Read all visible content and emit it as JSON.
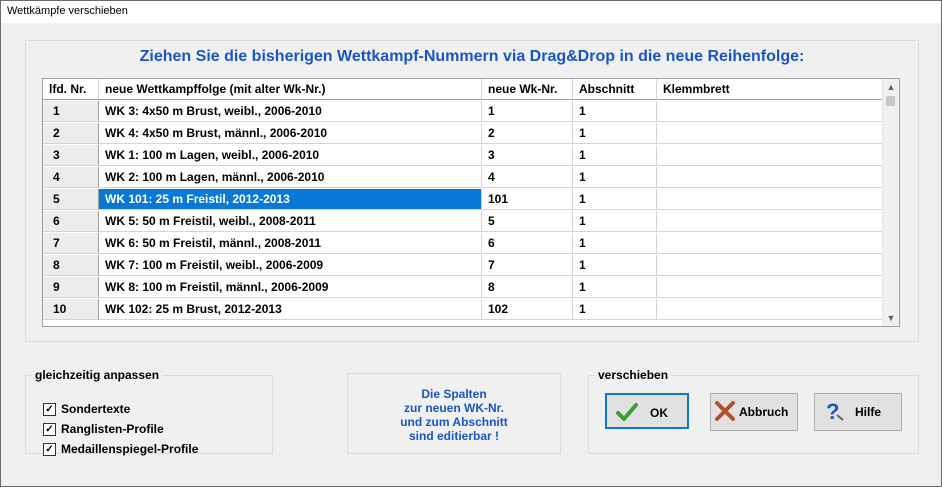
{
  "window": {
    "title": "Wettkämpfe verschieben"
  },
  "headline": "Ziehen Sie die bisherigen Wettkampf-Nummern via Drag&Drop in die neue Reihenfolge:",
  "grid": {
    "columns": [
      "lfd. Nr.",
      "neue Wettkampffolge  (mit alter Wk-Nr.)",
      "neue Wk-Nr.",
      "Abschnitt",
      "Klemmbrett"
    ],
    "rows": [
      {
        "nr": "1",
        "name": "WK 3: 4x50 m Brust, weibl., 2006-2010",
        "wknr": "1",
        "abschnitt": "1",
        "klemm": ""
      },
      {
        "nr": "2",
        "name": "WK 4: 4x50 m Brust, männl., 2006-2010",
        "wknr": "2",
        "abschnitt": "1",
        "klemm": ""
      },
      {
        "nr": "3",
        "name": "WK 1: 100 m Lagen, weibl., 2006-2010",
        "wknr": "3",
        "abschnitt": "1",
        "klemm": ""
      },
      {
        "nr": "4",
        "name": "WK 2: 100 m Lagen, männl., 2006-2010",
        "wknr": "4",
        "abschnitt": "1",
        "klemm": ""
      },
      {
        "nr": "5",
        "name": "WK 101: 25 m Freistil, 2012-2013",
        "wknr": "101",
        "abschnitt": "1",
        "klemm": "",
        "selected": true
      },
      {
        "nr": "6",
        "name": "WK 5: 50 m Freistil, weibl., 2008-2011",
        "wknr": "5",
        "abschnitt": "1",
        "klemm": ""
      },
      {
        "nr": "7",
        "name": "WK 6: 50 m Freistil, männl., 2008-2011",
        "wknr": "6",
        "abschnitt": "1",
        "klemm": ""
      },
      {
        "nr": "8",
        "name": "WK 7: 100 m Freistil, weibl., 2006-2009",
        "wknr": "7",
        "abschnitt": "1",
        "klemm": ""
      },
      {
        "nr": "9",
        "name": "WK 8: 100 m Freistil, männl., 2006-2009",
        "wknr": "8",
        "abschnitt": "1",
        "klemm": ""
      },
      {
        "nr": "10",
        "name": "WK 102: 25 m Brust, 2012-2013",
        "wknr": "102",
        "abschnitt": "1",
        "klemm": ""
      }
    ]
  },
  "anpassen": {
    "legend": "gleichzeitig anpassen",
    "options": [
      {
        "label": "Sondertexte",
        "checked": true,
        "mark": "✓"
      },
      {
        "label": "Ranglisten-Profile",
        "checked": true,
        "mark": "✓"
      },
      {
        "label": "Medaillenspiegel-Profile",
        "checked": true,
        "mark": "✓"
      }
    ]
  },
  "info": {
    "lines": [
      "Die Spalten",
      "zur neuen WK-Nr.",
      "und zum Abschnitt",
      "sind editierbar !"
    ]
  },
  "verschieben": {
    "legend": "verschieben"
  },
  "buttons": {
    "ok": "OK",
    "cancel": "Abbruch",
    "help": "Hilfe"
  },
  "colors": {
    "accent": "#1a56c8",
    "selection": "#0a78d7"
  },
  "icons": {
    "ok": "checkmark-icon",
    "cancel": "cross-icon",
    "help": "help-icon"
  }
}
